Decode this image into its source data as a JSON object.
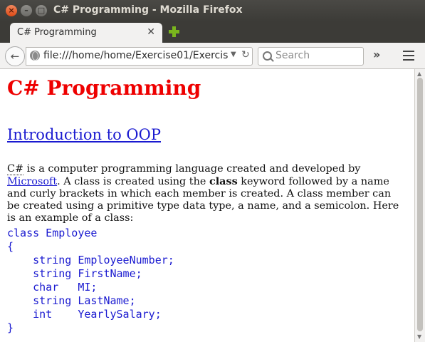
{
  "window": {
    "title": "C# Programming - Mozilla Firefox"
  },
  "tab": {
    "title": "C# Programming"
  },
  "nav": {
    "url": "file:///home/home/Exercise01/Exercis",
    "search_placeholder": "Search"
  },
  "page": {
    "heading": "C# Programming",
    "subheading": "Introduction to OOP",
    "paragraph": {
      "abbr": "C#",
      "text1": " is a computer programming language created and developed by ",
      "link": "Microsoft",
      "text2": ". A class is created using the ",
      "bold": "class",
      "text3": " keyword followed by a name and curly brackets in which each member is created. A class member can be created using a primitive type data type, a name, and a semicolon. Here is an example of a class:"
    },
    "code_lines": [
      "class Employee",
      "{",
      "    string EmployeeNumber;",
      "    string FirstName;",
      "    char   MI;",
      "    string LastName;",
      "    int    YearlySalary;",
      "}"
    ]
  },
  "colors": {
    "heading": "#ee0000",
    "link": "#1a1ad0",
    "code": "#1a1ad0"
  }
}
